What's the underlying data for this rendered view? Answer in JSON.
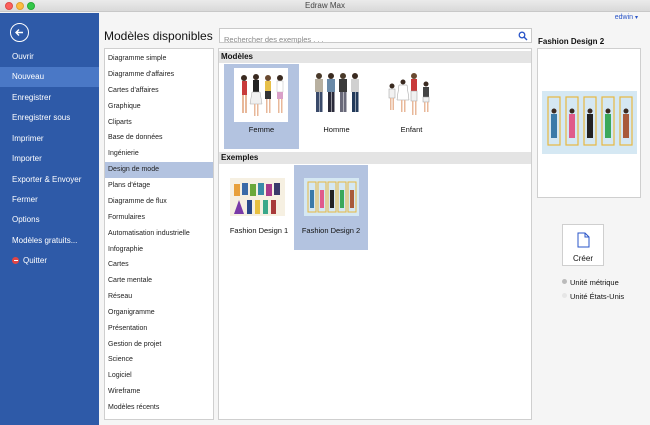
{
  "window": {
    "title": "Edraw Max"
  },
  "user": {
    "name": "edwin"
  },
  "sidebar": {
    "items": [
      {
        "label": "Ouvrir"
      },
      {
        "label": "Nouveau"
      },
      {
        "label": "Enregistrer"
      },
      {
        "label": "Enregistrer sous"
      },
      {
        "label": "Imprimer"
      },
      {
        "label": "Importer"
      },
      {
        "label": "Exporter & Envoyer"
      },
      {
        "label": "Fermer"
      },
      {
        "label": "Options"
      },
      {
        "label": "Modèles gratuits..."
      },
      {
        "label": "Quitter"
      }
    ],
    "active_index": 1
  },
  "main": {
    "heading": "Modèles disponibles",
    "search": {
      "placeholder": "Rechercher des exemples . . .",
      "value": ""
    }
  },
  "categories": {
    "items": [
      "Diagramme simple",
      "Diagramme d'affaires",
      "Cartes d'affaires",
      "Graphique",
      "Cliparts",
      "Base de données",
      "Ingénierie",
      "Design de mode",
      "Plans d'étage",
      "Diagramme de flux",
      "Formulaires",
      "Automatisation industrielle",
      "Infographie",
      "Cartes",
      "Carte mentale",
      "Réseau",
      "Organigramme",
      "Présentation",
      "Gestion de projet",
      "Science",
      "Logiciel",
      "Wireframe",
      "Modèles récents"
    ],
    "active_index": 7
  },
  "gallery": {
    "templates_header": "Modèles",
    "templates": [
      {
        "label": "Femme"
      },
      {
        "label": "Homme"
      },
      {
        "label": "Enfant"
      }
    ],
    "examples_header": "Exemples",
    "examples": [
      {
        "label": "Fashion Design 1"
      },
      {
        "label": "Fashion Design 2"
      }
    ]
  },
  "preview": {
    "title": "Fashion Design 2",
    "create_label": "Créer",
    "units": [
      {
        "label": "Unité métrique",
        "selected": true
      },
      {
        "label": "Unité États-Unis",
        "selected": false
      }
    ]
  },
  "colors": {
    "sidebar": "#2e5aa8",
    "sidebar_active": "#4a78c6",
    "selection": "#b3c3e0",
    "link": "#2a55c8"
  }
}
